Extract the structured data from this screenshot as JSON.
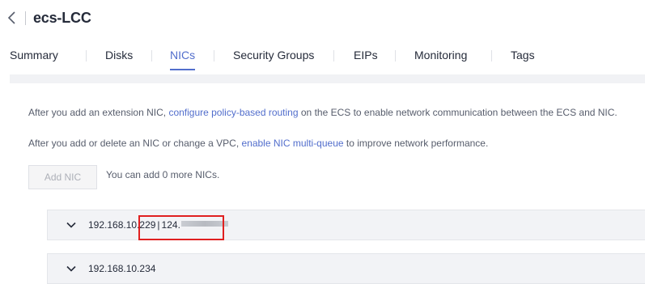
{
  "header": {
    "title": "ecs-LCC",
    "back_icon": "chevron-left-icon"
  },
  "tabs": [
    {
      "label": "Summary",
      "active": false
    },
    {
      "label": "Disks",
      "active": false
    },
    {
      "label": "NICs",
      "active": true
    },
    {
      "label": "Security Groups",
      "active": false
    },
    {
      "label": "EIPs",
      "active": false
    },
    {
      "label": "Monitoring",
      "active": false
    },
    {
      "label": "Tags",
      "active": false
    }
  ],
  "info": {
    "line1_pre": "After you add an extension NIC, ",
    "line1_link": "configure policy-based routing",
    "line1_post": " on the ECS to enable network communication between the ECS and NIC.",
    "line2_pre": "After you add or delete an NIC or change a VPC, ",
    "line2_link": "enable NIC multi-queue",
    "line2_post": " to improve network performance."
  },
  "add_nic": {
    "button_label": "Add NIC",
    "hint": "You can add 0 more NICs.",
    "disabled": true
  },
  "nics": [
    {
      "private_ip": "192.168.10.229",
      "separator": "|",
      "eip": "124.",
      "eip_redacted": true
    },
    {
      "private_ip": "192.168.10.234"
    }
  ],
  "colors": {
    "accent": "#526ecc",
    "highlight": "#e02020",
    "row_background": "#f2f3f6"
  }
}
